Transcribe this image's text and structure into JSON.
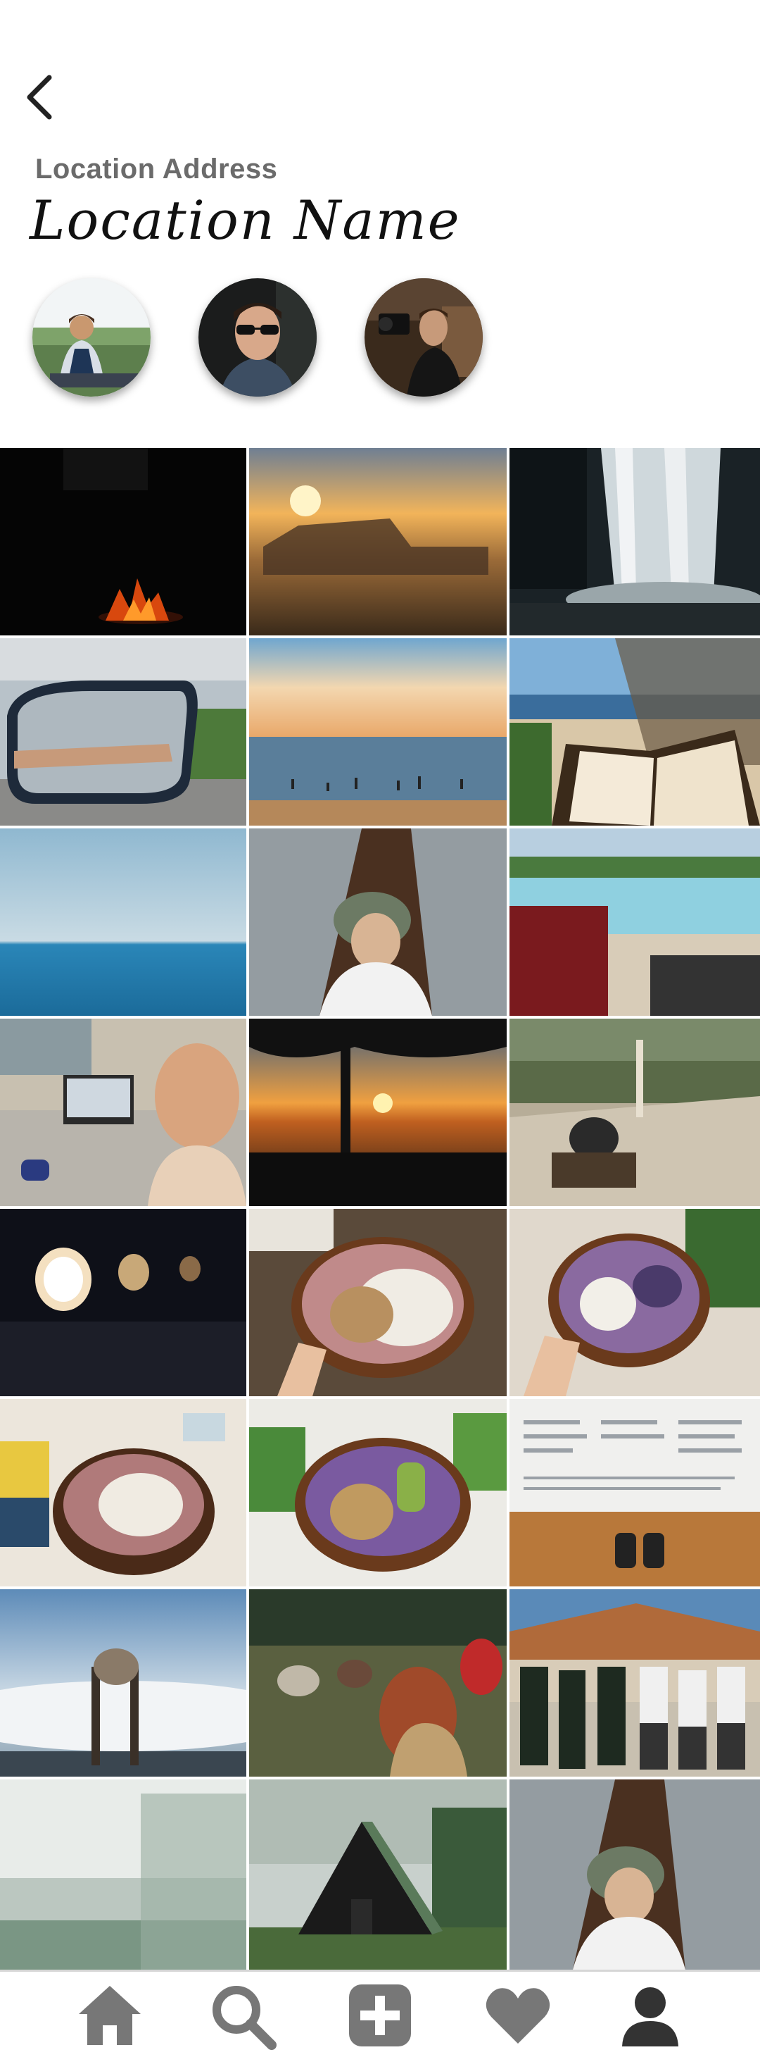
{
  "header": {
    "back_icon": "chevron-left-icon",
    "location_address": "Location Address",
    "location_name": "Location Name"
  },
  "visitors": [
    {
      "name": "avatar-woman-sitting",
      "icon": "avatar"
    },
    {
      "name": "avatar-man-sunglasses",
      "icon": "avatar"
    },
    {
      "name": "avatar-man-camera",
      "icon": "avatar"
    }
  ],
  "photos": [
    "campfire at night",
    "sunset behind truck",
    "waterfall",
    "car side mirror",
    "beach sunset swimmers",
    "reading book on beach",
    "ocean horizon",
    "woman in canoe",
    "laptop by pool",
    "laptop and selfie",
    "sunset with tree silhouette",
    "woman on boardwalk",
    "airplane cabin windows",
    "smoothie bowl",
    "smoothie bowl with berries",
    "smoothie bowl with candle",
    "smoothie bowl with kiwi",
    "document and shoes",
    "sign above clouds",
    "outdoor gathering",
    "group dancing",
    "misty forest",
    "a-frame cabin",
    "woman in canoe"
  ],
  "tabbar": {
    "items": [
      {
        "icon": "home-icon"
      },
      {
        "icon": "search-icon"
      },
      {
        "icon": "add-icon"
      },
      {
        "icon": "heart-icon"
      },
      {
        "icon": "profile-icon"
      }
    ],
    "color": "#777777"
  }
}
